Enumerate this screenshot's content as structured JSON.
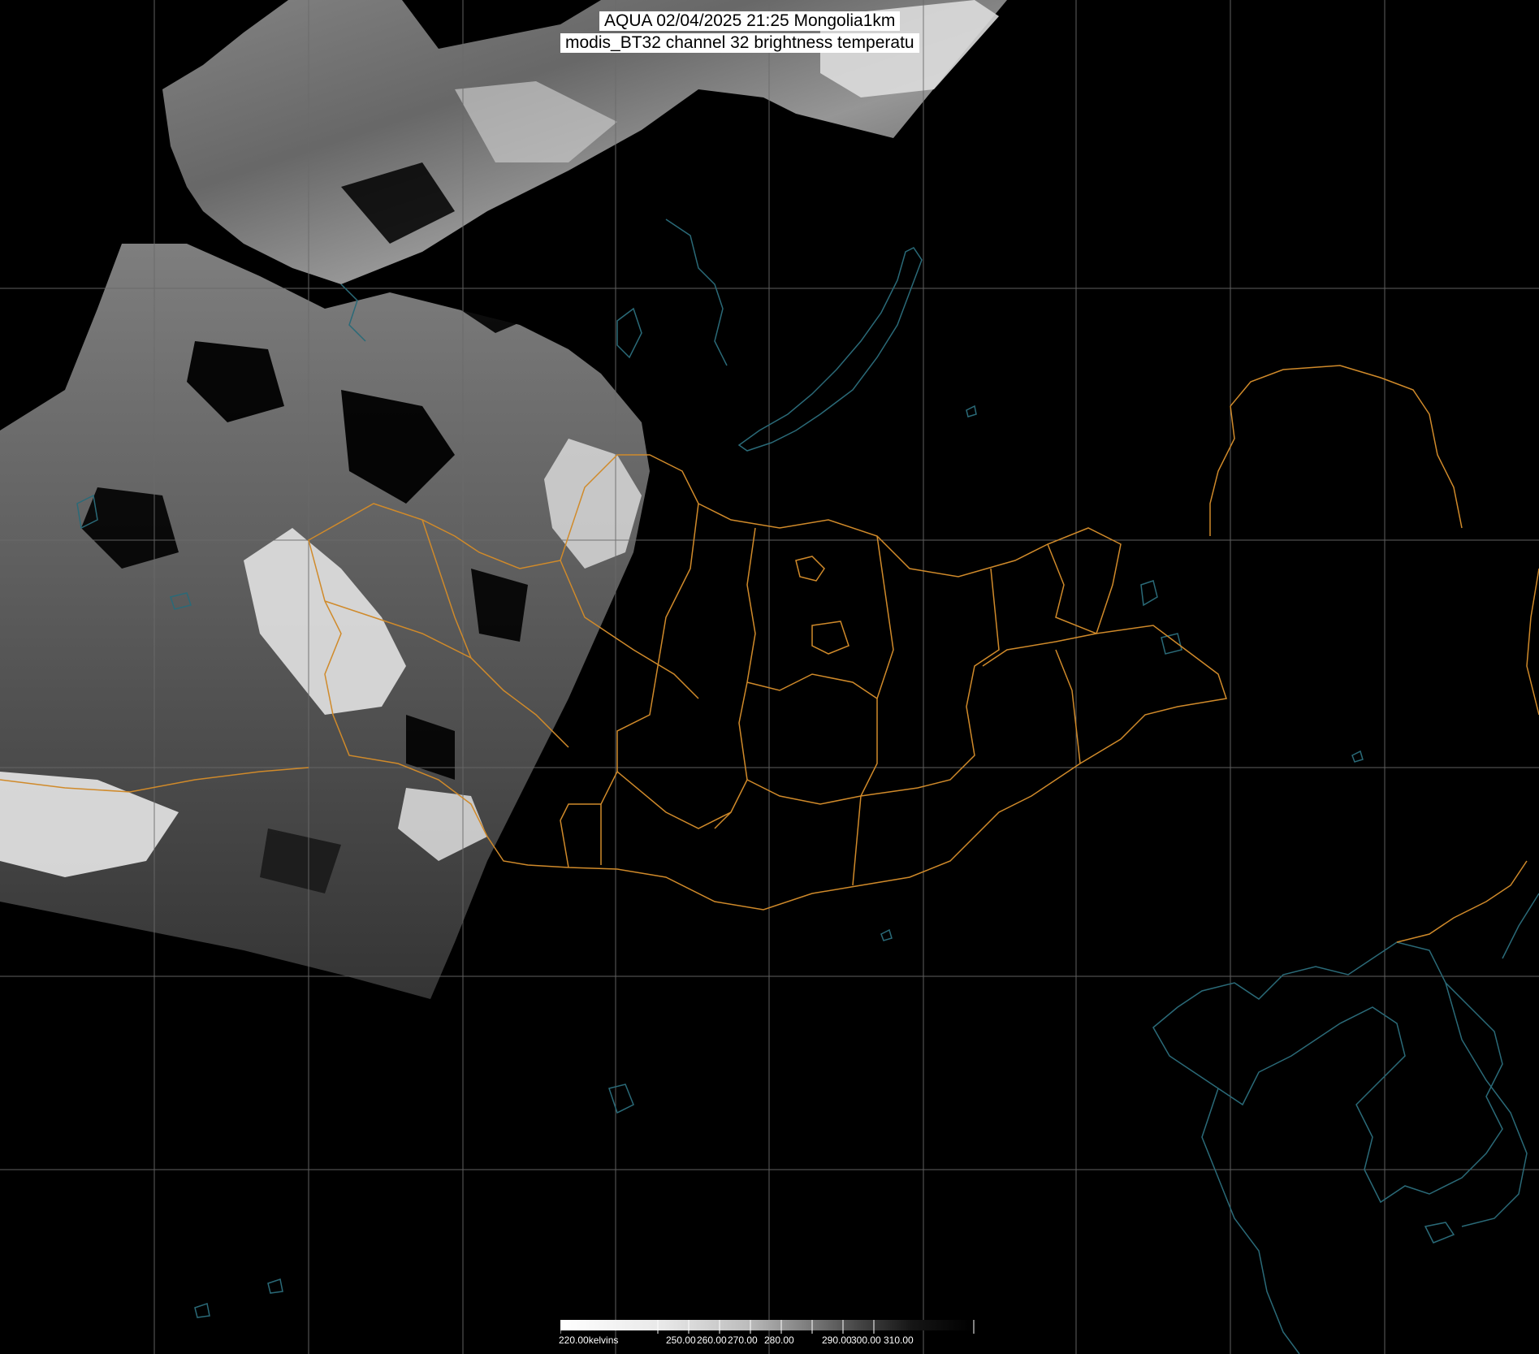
{
  "title": {
    "line1": "AQUA 02/04/2025 21:25 Mongolia1km",
    "line2": "modis_BT32 channel 32 brightness temperatu"
  },
  "colorbar": {
    "unit_label": "220.00kelvins",
    "tick_labels": [
      "250.00",
      "260.00",
      "270.00",
      "280.00",
      "290.00",
      "300.00",
      "310.00"
    ]
  },
  "colors": {
    "background": "#000000",
    "graticule": "#6a6a6a",
    "admin_boundaries": "#d08a2a",
    "coastlines_water": "#2a6a78",
    "imagery_light": "#e8e8e8",
    "imagery_dark": "#303030"
  }
}
